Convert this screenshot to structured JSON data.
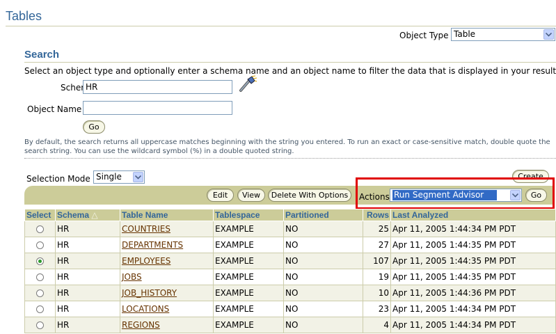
{
  "page": {
    "title": "Tables"
  },
  "object_type": {
    "label": "Object Type",
    "value": "Table"
  },
  "search": {
    "heading": "Search",
    "instructions": "Select an object type and optionally enter a schema name and an object name to filter the data that is displayed in your results set.",
    "schema_label": "Schema",
    "schema_value": "HR",
    "object_name_label": "Object Name",
    "object_name_value": "",
    "go_label": "Go",
    "hint": "By default, the search returns all uppercase matches beginning with the string you entered. To run an exact or case-sensitive match, double quote the search string. You can use the wildcard symbol (%) in a double quoted string."
  },
  "selection_mode": {
    "label": "Selection Mode",
    "value": "Single"
  },
  "create_label": "Create",
  "toolbar": {
    "edit_label": "Edit",
    "view_label": "View",
    "delete_label": "Delete With Options",
    "actions_label": "Actions",
    "actions_value": "Run Segment Advisor",
    "go_label": "Go"
  },
  "table": {
    "columns": [
      "Select",
      "Schema",
      "Table Name",
      "Tablespace",
      "Partitioned",
      "Rows",
      "Last Analyzed"
    ],
    "sort_indicator": "△",
    "rows": [
      {
        "selected": false,
        "schema": "HR",
        "table_name": "COUNTRIES",
        "tablespace": "EXAMPLE",
        "partitioned": "NO",
        "rows": "25",
        "last_analyzed": "Apr 11, 2005 1:44:34 PM PDT"
      },
      {
        "selected": false,
        "schema": "HR",
        "table_name": "DEPARTMENTS",
        "tablespace": "EXAMPLE",
        "partitioned": "NO",
        "rows": "27",
        "last_analyzed": "Apr 11, 2005 1:44:35 PM PDT"
      },
      {
        "selected": true,
        "schema": "HR",
        "table_name": "EMPLOYEES",
        "tablespace": "EXAMPLE",
        "partitioned": "NO",
        "rows": "107",
        "last_analyzed": "Apr 11, 2005 1:44:35 PM PDT"
      },
      {
        "selected": false,
        "schema": "HR",
        "table_name": "JOBS",
        "tablespace": "EXAMPLE",
        "partitioned": "NO",
        "rows": "19",
        "last_analyzed": "Apr 11, 2005 1:44:35 PM PDT"
      },
      {
        "selected": false,
        "schema": "HR",
        "table_name": "JOB_HISTORY",
        "tablespace": "EXAMPLE",
        "partitioned": "NO",
        "rows": "10",
        "last_analyzed": "Apr 11, 2005 1:44:36 PM PDT"
      },
      {
        "selected": false,
        "schema": "HR",
        "table_name": "LOCATIONS",
        "tablespace": "EXAMPLE",
        "partitioned": "NO",
        "rows": "23",
        "last_analyzed": "Apr 11, 2005 1:44:34 PM PDT"
      },
      {
        "selected": false,
        "schema": "HR",
        "table_name": "REGIONS",
        "tablespace": "EXAMPLE",
        "partitioned": "NO",
        "rows": "4",
        "last_analyzed": "Apr 11, 2005 1:44:34 PM PDT"
      }
    ]
  },
  "colors": {
    "title": "#336699",
    "header_bg": "#cccc99",
    "link": "#663300",
    "highlight": "#e00000",
    "selected_option": "#316ac5"
  }
}
